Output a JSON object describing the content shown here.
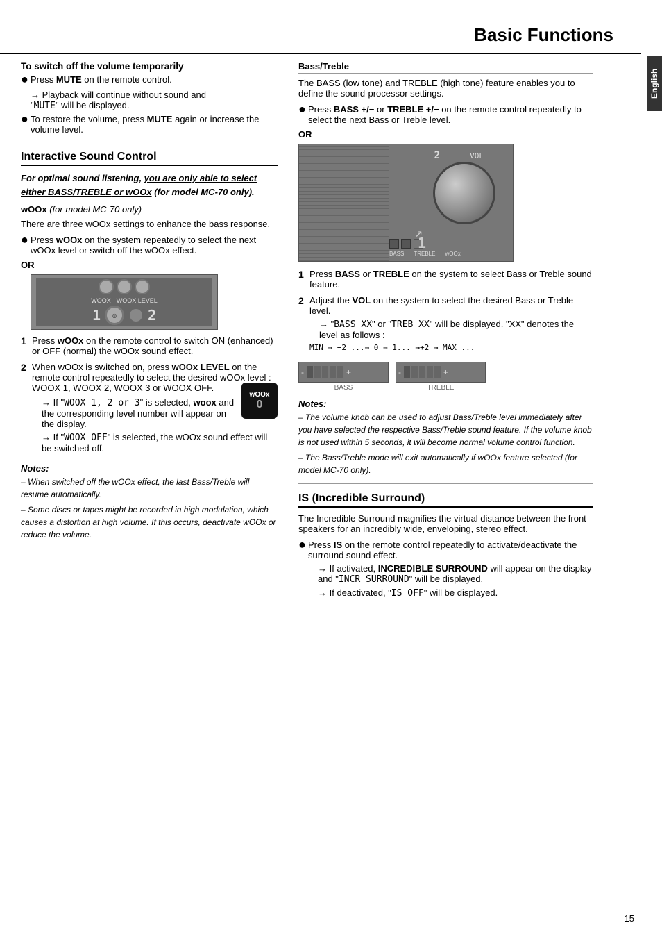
{
  "page": {
    "title": "Basic Functions",
    "page_number": "15",
    "language_tab": "English"
  },
  "left_col": {
    "section1": {
      "heading": "To switch off the volume temporarily",
      "bullet1": {
        "text_before": "Press ",
        "bold": "MUTE",
        "text_after": " on the remote control."
      },
      "arrow1": "→ Playback will continue without sound and \"MUTE\" will be displayed.",
      "bullet2_before": "To restore the volume, press ",
      "bullet2_bold": "MUTE",
      "bullet2_after": " again or increase the volume level."
    },
    "section2": {
      "heading": "Interactive Sound Control",
      "intro_italic": "For optimal sound listening, you are only able to select either BASS/TREBLE or wOOx (for model MC-70 only).",
      "woox_heading": "wOOx",
      "woox_heading_suffix": " (for model MC-70 only)",
      "woox_desc": "There are three wOOx settings to enhance the bass response.",
      "bullet1_before": "Press ",
      "bullet1_bold": "wOOx",
      "bullet1_after": " on the system repeatedly to select the next wOOx level or switch off the wOOx effect.",
      "or_label": "OR",
      "numbered": {
        "item1_before": "Press ",
        "item1_bold": "wOOx",
        "item1_after": " on the remote control to switch ON (enhanced) or OFF (normal) the wOOx sound effect.",
        "item2_before": "When wOOx is switched on, press ",
        "item2_bold1": "wOOx",
        "item2_bold2": "LEVEL",
        "item2_after": " on the remote control repeatedly to select the desired wOOx level : WOOX 1, WOOX 2, WOOX 3 or WOOX OFF.",
        "arrow1": "→ If \"WOOX 1, 2 or 3\" is selected, woox and the corresponding level number will appear on the display.",
        "arrow2": "→ If \"WOOX OFF\" is selected, the wOOx sound effect will be switched off."
      }
    },
    "notes": {
      "title": "Notes:",
      "note1": "– When switched off the wOOx effect, the last Bass/Treble will resume automatically.",
      "note2": "– Some discs or tapes might be recorded in high modulation, which causes a distortion at high volume. If this occurs, deactivate wOOx or reduce the volume."
    }
  },
  "right_col": {
    "section1": {
      "heading": "Bass/Treble",
      "desc": "The BASS (low tone) and TREBLE (high tone) feature enables you to define the sound-processor settings.",
      "bullet1_before": "Press ",
      "bullet1_bold1": "BASS",
      "bullet1_mid1": " +/− or ",
      "bullet1_bold2": "TREBLE",
      "bullet1_mid2": " +/− on the remote control repeatedly to select the next Bass or Treble level.",
      "or_label": "OR",
      "numbered": {
        "item1_before": "Press ",
        "item1_bold1": "BASS",
        "item1_mid": " or ",
        "item1_bold2": "TREBLE",
        "item1_after": " on the system to select Bass or Treble sound feature.",
        "item2_before": "Adjust the ",
        "item2_bold": "VOL",
        "item2_after": " on the system to select the desired Bass or Treble level.",
        "arrow1": "→ \"BASS XX\" or \"TREB XX\" will be displayed. \"XX\" denotes the level as follows :",
        "minmax_line": "MIN → −2 ...→ 0 → 1... →+2 → MAX ..."
      }
    },
    "notes": {
      "title": "Notes:",
      "note1": "– The volume knob can be used to adjust Bass/Treble level immediately after you have selected the respective Bass/Treble sound feature. If the volume knob is not used within 5 seconds, it will become normal volume control function.",
      "note2": "– The Bass/Treble mode will exit automatically if wOOx feature selected (for model MC-70 only)."
    },
    "section2": {
      "heading": "IS (Incredible Surround)",
      "desc": "The Incredible Surround magnifies the virtual distance between the front speakers for an incredibly wide, enveloping, stereo effect.",
      "bullet1_before": "Press ",
      "bullet1_bold": "IS",
      "bullet1_after": " on the remote control repeatedly to activate/deactivate the surround sound effect.",
      "arrow1": "→ If activated, INCREDIBLE SURROUND will appear on the display and \"INCR SURROUND\" will be displayed.",
      "arrow2": "→ If deactivated, \"IS OFF\" will be displayed."
    }
  }
}
